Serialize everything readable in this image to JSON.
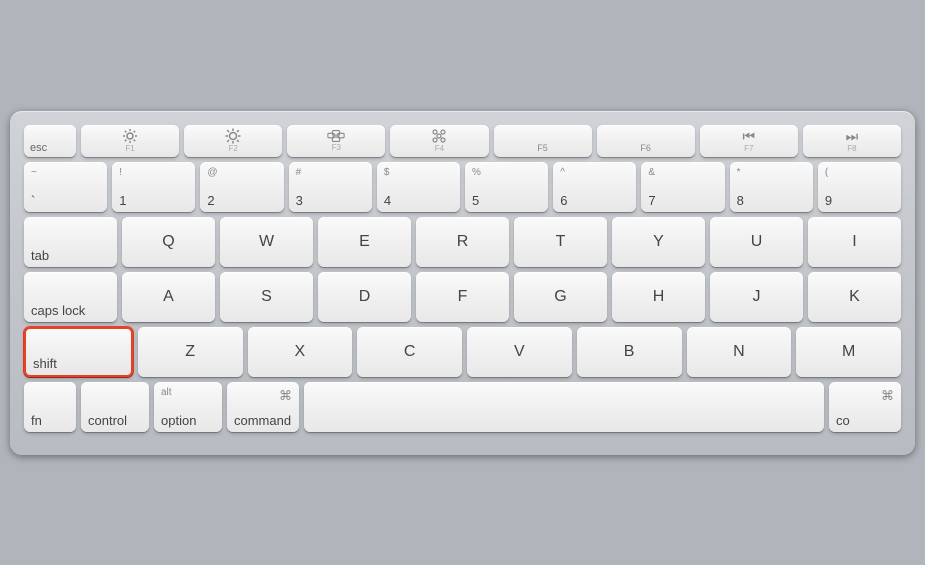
{
  "keyboard": {
    "rows": {
      "fn": {
        "keys": [
          "esc",
          "F1",
          "F2",
          "F3",
          "F4",
          "F5",
          "F6",
          "F7",
          "F8"
        ]
      },
      "number": {
        "keys": [
          {
            "top": "~",
            "bottom": "`"
          },
          {
            "top": "!",
            "bottom": "1"
          },
          {
            "top": "@",
            "bottom": "2"
          },
          {
            "top": "#",
            "bottom": "3"
          },
          {
            "top": "$",
            "bottom": "4"
          },
          {
            "top": "%",
            "bottom": "5"
          },
          {
            "top": "^",
            "bottom": "6"
          },
          {
            "top": "&",
            "bottom": "7"
          },
          {
            "top": "*",
            "bottom": "8"
          },
          {
            "top": "(",
            "bottom": "9"
          }
        ]
      },
      "qwerty": [
        "tab",
        "Q",
        "W",
        "E",
        "R",
        "T",
        "Y",
        "U",
        "I"
      ],
      "asdf": [
        "caps lock",
        "A",
        "S",
        "D",
        "F",
        "G",
        "H",
        "J",
        "K"
      ],
      "zxcv": [
        "shift",
        "Z",
        "X",
        "C",
        "V",
        "B",
        "N",
        "M"
      ],
      "bottom": [
        "fn",
        "control",
        "option",
        "command",
        "command"
      ]
    },
    "shift_highlighted": true,
    "shift_label": "shift"
  }
}
